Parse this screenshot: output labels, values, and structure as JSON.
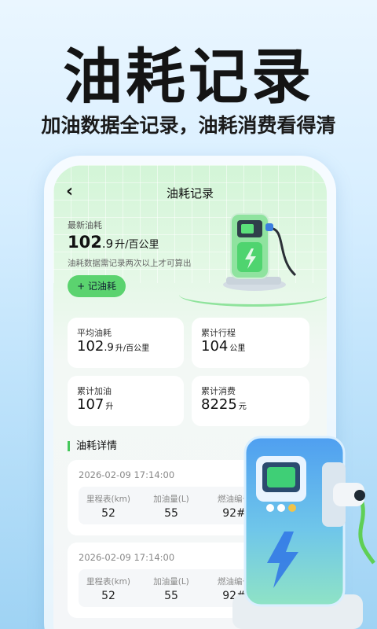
{
  "promo": {
    "title": "油耗记录",
    "subtitle": "加油数据全记录，油耗消费看得清"
  },
  "nav": {
    "back_icon": "‹",
    "title": "油耗记录"
  },
  "latest": {
    "label": "最新油耗",
    "int": "102",
    "dec": ".9",
    "unit": "升/百公里",
    "note": "油耗数据需记录两次以上才可算出",
    "add_button": "+ 记油耗"
  },
  "stats": {
    "avg": {
      "label": "平均油耗",
      "int": "102",
      "dec": ".9",
      "unit": "升/百公里"
    },
    "mileage": {
      "label": "累计行程",
      "value": "104",
      "unit": "公里"
    },
    "fuel": {
      "label": "累计加油",
      "value": "107",
      "unit": "升"
    },
    "spend": {
      "label": "累计消费",
      "value": "8225",
      "unit": "元"
    }
  },
  "section_title": "油耗详情",
  "records": [
    {
      "date": "2026-02-09 17:14:00",
      "headers": [
        "里程表(km)",
        "加油量(L)",
        "燃油编号"
      ],
      "values": [
        "52",
        "55",
        "92#"
      ]
    },
    {
      "date": "2026-02-09 17:14:00",
      "headers": [
        "里程表(km)",
        "加油量(L)",
        "燃油编号"
      ],
      "values": [
        "52",
        "55",
        "92#"
      ]
    }
  ],
  "colors": {
    "accent": "#5bd36f",
    "section_bar": "#46c85c",
    "pump_blue": "#3a8fe8"
  },
  "icons": {
    "back": "chevron-left-icon",
    "fuel_pump": "fuel-pump-icon",
    "bolt": "lightning-bolt-icon"
  }
}
